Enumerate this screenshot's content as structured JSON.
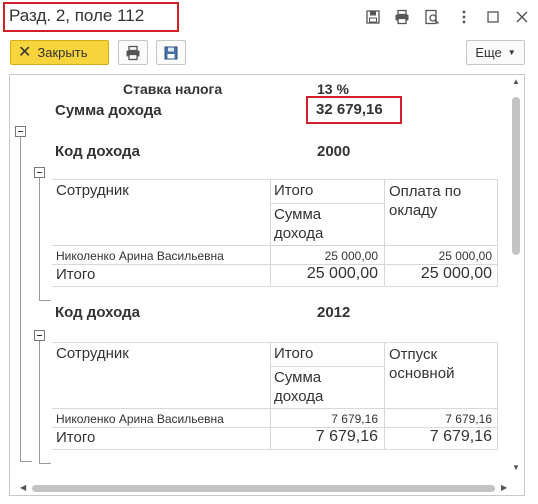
{
  "window": {
    "title": "Разд. 2, поле 112",
    "icons": [
      "save-icon",
      "print-icon",
      "preview-icon",
      "more-vertical-icon",
      "maximize-icon",
      "close-icon"
    ]
  },
  "toolbar": {
    "close_label": "Закрыть",
    "more_label": "Еще",
    "accent_color": "#f7d43c"
  },
  "report": {
    "tax_rate_label": "Ставка налога",
    "tax_rate_value": "13 %",
    "income_sum_label": "Сумма дохода",
    "income_sum_value": "32 679,16",
    "groups": [
      {
        "code_label": "Код дохода",
        "code_value": "2000",
        "headers": {
          "employee": "Сотрудник",
          "total": "Итого",
          "total_sub": "Сумма дохода",
          "detail": "Оплата по окладу"
        },
        "rows": [
          {
            "employee": "Николенко Арина Васильевна",
            "total": "25 000,00",
            "detail": "25 000,00"
          }
        ],
        "footer": {
          "label": "Итого",
          "total": "25 000,00",
          "detail": "25 000,00"
        }
      },
      {
        "code_label": "Код дохода",
        "code_value": "2012",
        "headers": {
          "employee": "Сотрудник",
          "total": "Итого",
          "total_sub": "Сумма дохода",
          "detail": "Отпуск основной"
        },
        "rows": [
          {
            "employee": "Николенко Арина Васильевна",
            "total": "7 679,16",
            "detail": "7 679,16"
          }
        ],
        "footer": {
          "label": "Итого",
          "total": "7 679,16",
          "detail": "7 679,16"
        }
      }
    ]
  }
}
